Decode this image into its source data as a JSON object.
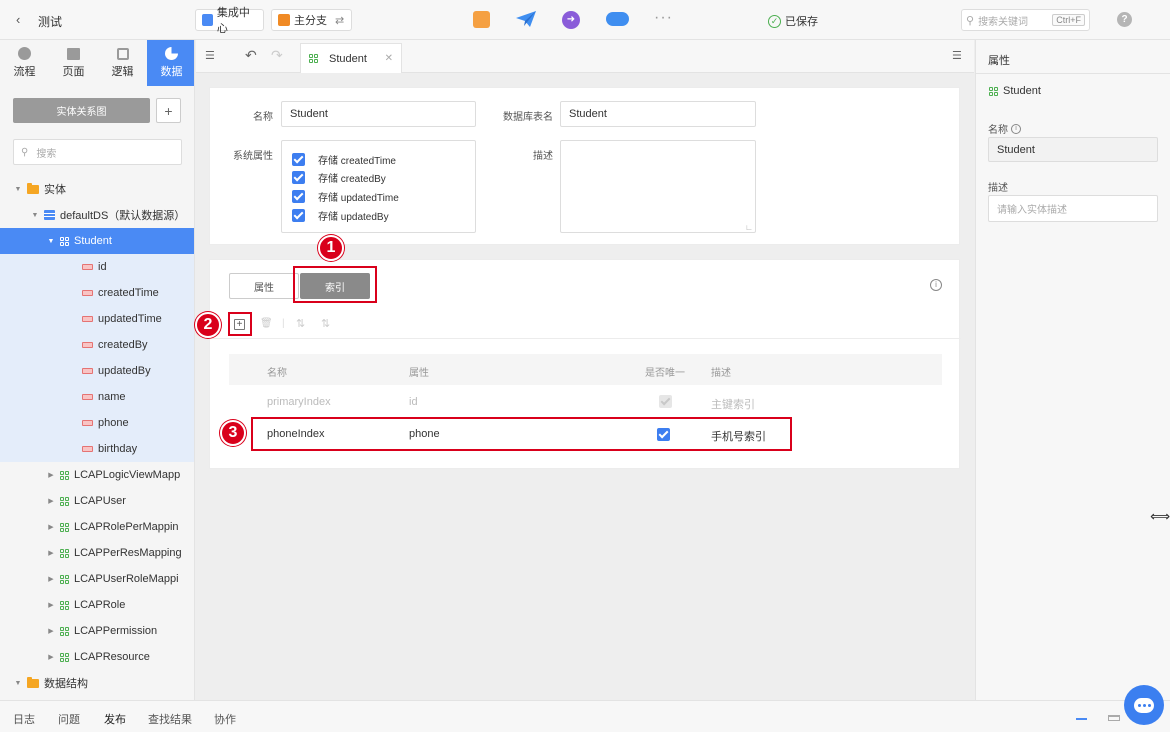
{
  "header": {
    "project_title": "测试",
    "integration_center": "集成中心",
    "branch": "主分支",
    "saved_status": "已保存",
    "search_placeholder": "搜索关键词",
    "search_shortcut": "Ctrl+F"
  },
  "nav_tabs": [
    {
      "label": "流程",
      "icon": "flow-icon"
    },
    {
      "label": "页面",
      "icon": "page-icon"
    },
    {
      "label": "逻辑",
      "icon": "chip-icon"
    },
    {
      "label": "数据",
      "icon": "pie-chart-icon"
    }
  ],
  "sidebar": {
    "er_button": "实体关系图",
    "search_placeholder": "搜索",
    "tree": [
      {
        "label": "实体",
        "type": "folder",
        "level": 0,
        "expanded": true
      },
      {
        "label": "defaultDS（默认数据源）",
        "type": "datasource",
        "level": 1,
        "expanded": true
      },
      {
        "label": "Student",
        "type": "entity",
        "level": 2,
        "expanded": true,
        "selected": true
      },
      {
        "label": "id",
        "type": "field",
        "level": 3
      },
      {
        "label": "createdTime",
        "type": "field",
        "level": 3
      },
      {
        "label": "updatedTime",
        "type": "field",
        "level": 3
      },
      {
        "label": "createdBy",
        "type": "field",
        "level": 3
      },
      {
        "label": "updatedBy",
        "type": "field",
        "level": 3
      },
      {
        "label": "name",
        "type": "field",
        "level": 3
      },
      {
        "label": "phone",
        "type": "field",
        "level": 3
      },
      {
        "label": "birthday",
        "type": "field",
        "level": 3
      },
      {
        "label": "LCAPLogicViewMapp",
        "type": "entity",
        "level": 2
      },
      {
        "label": "LCAPUser",
        "type": "entity",
        "level": 2
      },
      {
        "label": "LCAPRolePerMappin",
        "type": "entity",
        "level": 2
      },
      {
        "label": "LCAPPerResMapping",
        "type": "entity",
        "level": 2
      },
      {
        "label": "LCAPUserRoleMappi",
        "type": "entity",
        "level": 2
      },
      {
        "label": "LCAPRole",
        "type": "entity",
        "level": 2
      },
      {
        "label": "LCAPPermission",
        "type": "entity",
        "level": 2
      },
      {
        "label": "LCAPResource",
        "type": "entity",
        "level": 2
      },
      {
        "label": "数据结构",
        "type": "folder",
        "level": 0,
        "expanded": true
      }
    ]
  },
  "editor": {
    "tab_title": "Student",
    "form": {
      "name_label": "名称",
      "name_value": "Student",
      "table_label": "数据库表名",
      "table_value": "Student",
      "sys_label": "系统属性",
      "desc_label": "描述",
      "sys_options": [
        "存储 createdTime",
        "存储 createdBy",
        "存储 updatedTime",
        "存储 updatedBy"
      ]
    },
    "seg_tabs": [
      "属性",
      "索引"
    ],
    "table": {
      "headers": [
        "名称",
        "属性",
        "是否唯一",
        "描述"
      ],
      "rows": [
        {
          "name": "primaryIndex",
          "prop": "id",
          "unique": true,
          "desc": "主键索引",
          "disabled": true
        },
        {
          "name": "phoneIndex",
          "prop": "phone",
          "unique": true,
          "desc": "手机号索引",
          "disabled": false
        }
      ]
    },
    "callouts": [
      "1",
      "2",
      "3"
    ]
  },
  "inspector": {
    "title": "属性",
    "entity_name": "Student",
    "name_label": "名称",
    "name_value": "Student",
    "desc_label": "描述",
    "desc_placeholder": "请输入实体描述"
  },
  "bottom_tabs": [
    "日志",
    "问题",
    "发布",
    "查找结果",
    "协作"
  ],
  "colors": {
    "accent": "#4a8af4",
    "callout": "#d9001b"
  }
}
